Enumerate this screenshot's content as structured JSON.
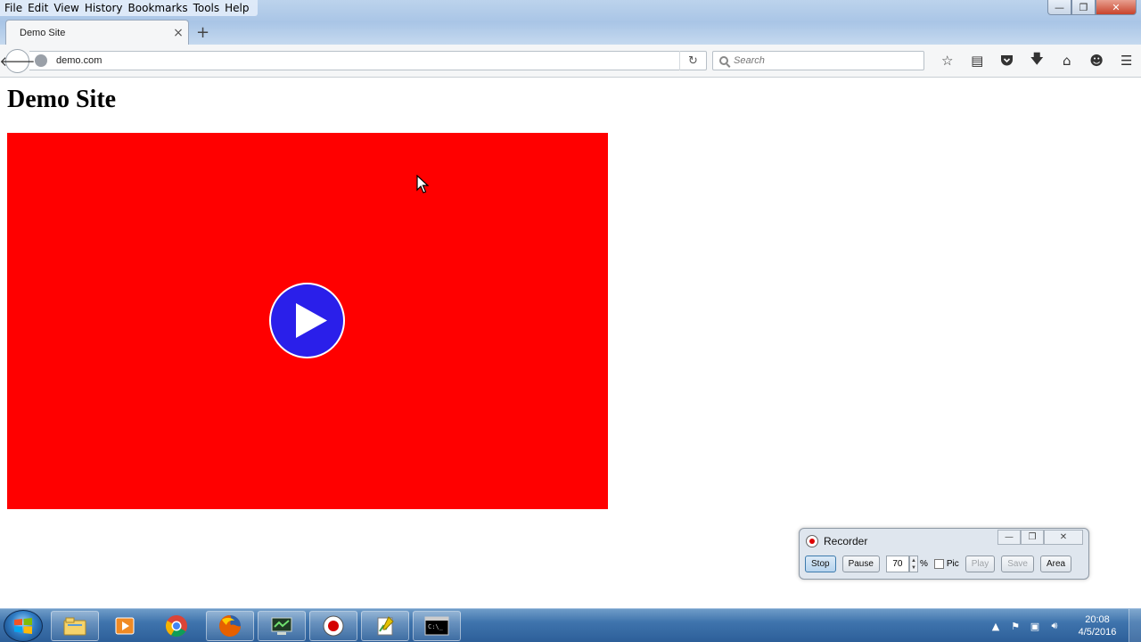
{
  "menu": {
    "items": [
      {
        "label": "File"
      },
      {
        "label": "Edit"
      },
      {
        "label": "View"
      },
      {
        "label": "History"
      },
      {
        "label": "Bookmarks"
      },
      {
        "label": "Tools"
      },
      {
        "label": "Help"
      }
    ]
  },
  "window_controls": {
    "minimize": "—",
    "maximize": "❐",
    "close": "✕"
  },
  "tab": {
    "title": "Demo Site",
    "close": "×",
    "new_tab": "+"
  },
  "navbar": {
    "url": "demo.com",
    "search_placeholder": "Search",
    "toolbar_icons": [
      "bookmark-star-icon",
      "reading-list-icon",
      "pocket-icon",
      "downloads-icon",
      "home-icon",
      "hello-icon",
      "menu-icon"
    ]
  },
  "page": {
    "title": "Demo Site",
    "video_background": "#ff0000",
    "play_button_color": "#2a1fea"
  },
  "recorder": {
    "title": "Recorder",
    "stop": "Stop",
    "pause": "Pause",
    "zoom_value": "70",
    "zoom_unit": "%",
    "pic_label": "Pic",
    "play": "Play",
    "save": "Save",
    "area": "Area"
  },
  "taskbar": {
    "apps": [
      "file-explorer-icon",
      "media-player-icon",
      "chrome-icon",
      "firefox-icon",
      "screen-capture-icon",
      "recorder-app-icon",
      "notepad-icon",
      "command-prompt-icon"
    ],
    "clock_time": "20:08",
    "clock_date": "4/5/2016"
  }
}
